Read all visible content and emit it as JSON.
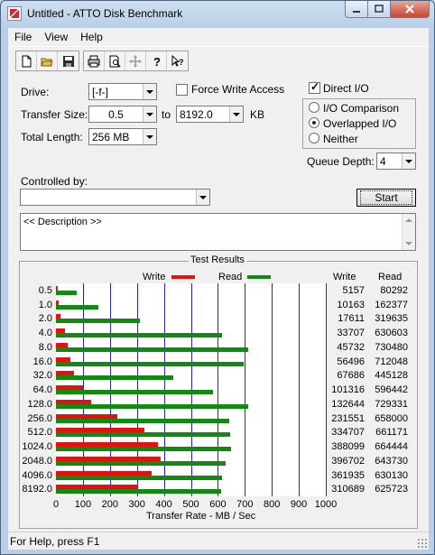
{
  "window": {
    "title": "Untitled - ATTO Disk Benchmark"
  },
  "menu": [
    "File",
    "View",
    "Help"
  ],
  "toolbar": [
    "new-icon",
    "open-icon",
    "save-icon",
    "print-icon",
    "print-preview-icon",
    "move-icon",
    "help-icon",
    "context-help-icon"
  ],
  "form": {
    "drive_label": "Drive:",
    "drive_value": "[-f-]",
    "force_write_label": "Force Write Access",
    "force_write_checked": false,
    "direct_io_label": "Direct I/O",
    "direct_io_checked": true,
    "transfer_size_label": "Transfer Size:",
    "transfer_from": "0.5",
    "to_label": "to",
    "transfer_to": "8192.0",
    "kb_label": "KB",
    "total_length_label": "Total Length:",
    "total_length_value": "256 MB",
    "io_options": [
      "I/O Comparison",
      "Overlapped I/O",
      "Neither"
    ],
    "io_selected": "Overlapped I/O",
    "queue_depth_label": "Queue Depth:",
    "queue_depth_value": "4",
    "controlled_by_label": "Controlled by:",
    "controlled_by_value": "",
    "start_label": "Start",
    "description": "<< Description >>"
  },
  "results": {
    "title": "Test Results",
    "write_label": "Write",
    "read_label": "Read",
    "col_write": "Write",
    "col_read": "Read",
    "write_color": "#e61010",
    "read_color": "#128a12"
  },
  "chart_data": {
    "type": "bar",
    "orientation": "horizontal",
    "categories": [
      "0.5",
      "1.0",
      "2.0",
      "4.0",
      "8.0",
      "16.0",
      "32.0",
      "64.0",
      "128.0",
      "256.0",
      "512.0",
      "1024.0",
      "2048.0",
      "4096.0",
      "8192.0"
    ],
    "series": [
      {
        "name": "Write",
        "values": [
          5157,
          10163,
          17611,
          33707,
          45732,
          56496,
          67686,
          101316,
          132644,
          231551,
          334707,
          388099,
          396702,
          361935,
          310689
        ]
      },
      {
        "name": "Read",
        "values": [
          80292,
          162377,
          319635,
          630603,
          730480,
          712048,
          445128,
          596442,
          729331,
          658000,
          661171,
          664444,
          643730,
          630130,
          625723
        ]
      }
    ],
    "xlabel": "Transfer Rate - MB / Sec",
    "xticks": [
      0,
      100,
      200,
      300,
      400,
      500,
      600,
      700,
      800,
      900,
      1000
    ],
    "xlim": [
      0,
      1000
    ],
    "grid": true,
    "legend": "top"
  },
  "status": "For Help, press F1"
}
